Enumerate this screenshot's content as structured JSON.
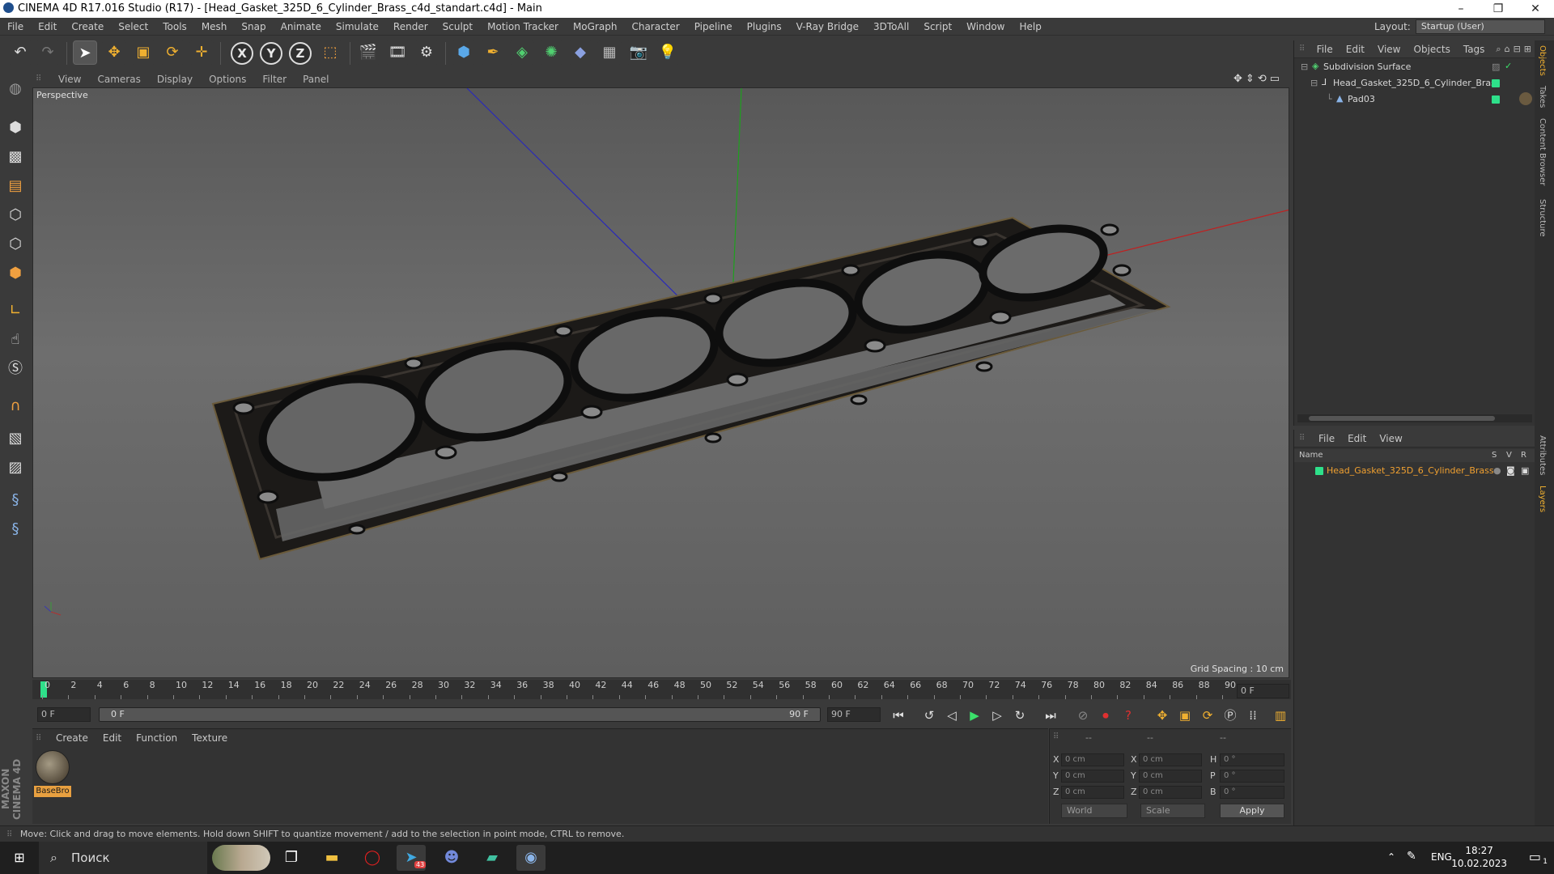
{
  "window": {
    "title": "CINEMA 4D R17.016 Studio (R17) - [Head_Gasket_325D_6_Cylinder_Brass_c4d_standart.c4d] - Main",
    "controls": [
      "–",
      "❐",
      "✕"
    ]
  },
  "menubar": {
    "items": [
      "File",
      "Edit",
      "Create",
      "Select",
      "Tools",
      "Mesh",
      "Snap",
      "Animate",
      "Simulate",
      "Render",
      "Sculpt",
      "Motion Tracker",
      "MoGraph",
      "Character",
      "Pipeline",
      "Plugins",
      "V-Ray Bridge",
      "3DToAll",
      "Script",
      "Window",
      "Help"
    ],
    "layout_label": "Layout:",
    "layout_value": "Startup (User)"
  },
  "toolbar": {
    "axes": [
      "X",
      "Y",
      "Z"
    ]
  },
  "viewport": {
    "menu": [
      "View",
      "Cameras",
      "Display",
      "Options",
      "Filter",
      "Panel"
    ],
    "label": "Perspective",
    "grid_spacing": "Grid Spacing : 10 cm"
  },
  "timeline": {
    "ticks": [
      "0",
      "2",
      "4",
      "6",
      "8",
      "10",
      "12",
      "14",
      "16",
      "18",
      "20",
      "22",
      "24",
      "26",
      "28",
      "30",
      "32",
      "34",
      "36",
      "38",
      "40",
      "42",
      "44",
      "46",
      "48",
      "50",
      "52",
      "54",
      "56",
      "58",
      "60",
      "62",
      "64",
      "66",
      "68",
      "70",
      "72",
      "74",
      "76",
      "78",
      "80",
      "82",
      "84",
      "86",
      "88",
      "90"
    ],
    "current_frame": "0 F",
    "start_field": "0 F",
    "range_start": "0 F",
    "range_end": "90 F",
    "end_field": "90 F"
  },
  "materials": {
    "menu": [
      "Create",
      "Edit",
      "Function",
      "Texture"
    ],
    "items": [
      {
        "name": "BaseBro"
      }
    ]
  },
  "coordinates": {
    "header": [
      "--",
      "--",
      "--"
    ],
    "pos_labels": [
      "X",
      "Y",
      "Z"
    ],
    "pos_values": [
      "0 cm",
      "0 cm",
      "0 cm"
    ],
    "size_labels": [
      "X",
      "Y",
      "Z"
    ],
    "size_values": [
      "0 cm",
      "0 cm",
      "0 cm"
    ],
    "rot_labels": [
      "H",
      "P",
      "B"
    ],
    "rot_values": [
      "0 °",
      "0 °",
      "0 °"
    ],
    "mode": "World",
    "mode2": "Scale",
    "apply": "Apply"
  },
  "object_manager": {
    "menu": [
      "File",
      "Edit",
      "View",
      "Objects",
      "Tags"
    ],
    "objects": [
      "Subdivision Surface",
      "Head_Gasket_325D_6_Cylinder_Brass",
      "Pad03"
    ]
  },
  "layer_manager": {
    "menu": [
      "File",
      "Edit",
      "View"
    ],
    "header_name": "Name",
    "header_cols": [
      "S",
      "V",
      "R"
    ],
    "layers": [
      "Head_Gasket_325D_6_Cylinder_Brass"
    ]
  },
  "side_tabs": [
    "Objects",
    "Takes",
    "Content Browser",
    "Structure",
    "Attributes",
    "Layers"
  ],
  "maxon_logo": "MAXON CINEMA 4D",
  "status": "Move: Click and drag to move elements. Hold down SHIFT to quantize movement / add to the selection in point mode, CTRL to remove.",
  "taskbar": {
    "search": "Поиск",
    "tray_lang": "ENG",
    "time": "18:27",
    "date": "10.02.2023",
    "telegram_badge": "43",
    "notif_badge": "1"
  }
}
